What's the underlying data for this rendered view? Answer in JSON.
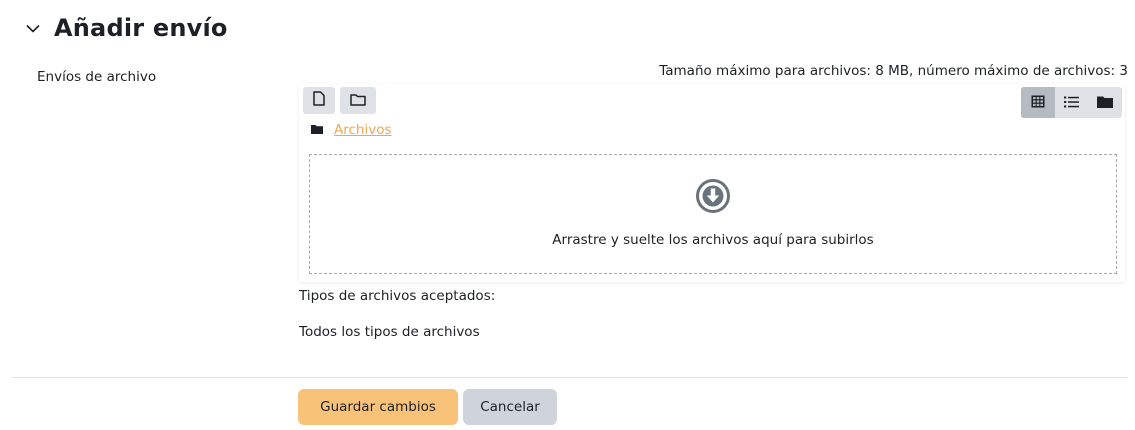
{
  "section": {
    "title": "Añadir envío",
    "toggle_icon": "chevron-down-icon"
  },
  "field": {
    "label": "Envíos de archivo",
    "max_size_text": "Tamaño máximo para archivos: 8 MB, número máximo de archivos: 3"
  },
  "filemanager": {
    "toolbar": {
      "add_file_icon": "file-icon",
      "add_folder_icon": "folder-outline-icon",
      "views": [
        {
          "icon": "grid-icon",
          "active": true
        },
        {
          "icon": "list-icon",
          "active": false
        },
        {
          "icon": "folder-tree-icon",
          "active": false
        }
      ]
    },
    "path": {
      "icon": "folder-icon",
      "label": "Archivos"
    },
    "dropzone": {
      "icon": "download-circle-icon",
      "text": "Arrastre y suelte los archivos aquí para subirlos"
    }
  },
  "accepted": {
    "label": "Tipos de archivos aceptados:",
    "value": "Todos los tipos de archivos"
  },
  "buttons": {
    "save": "Guardar cambios",
    "cancel": "Cancelar"
  },
  "colors": {
    "primary": "#f9c279",
    "secondary": "#ced4da",
    "link": "#f0a650"
  }
}
